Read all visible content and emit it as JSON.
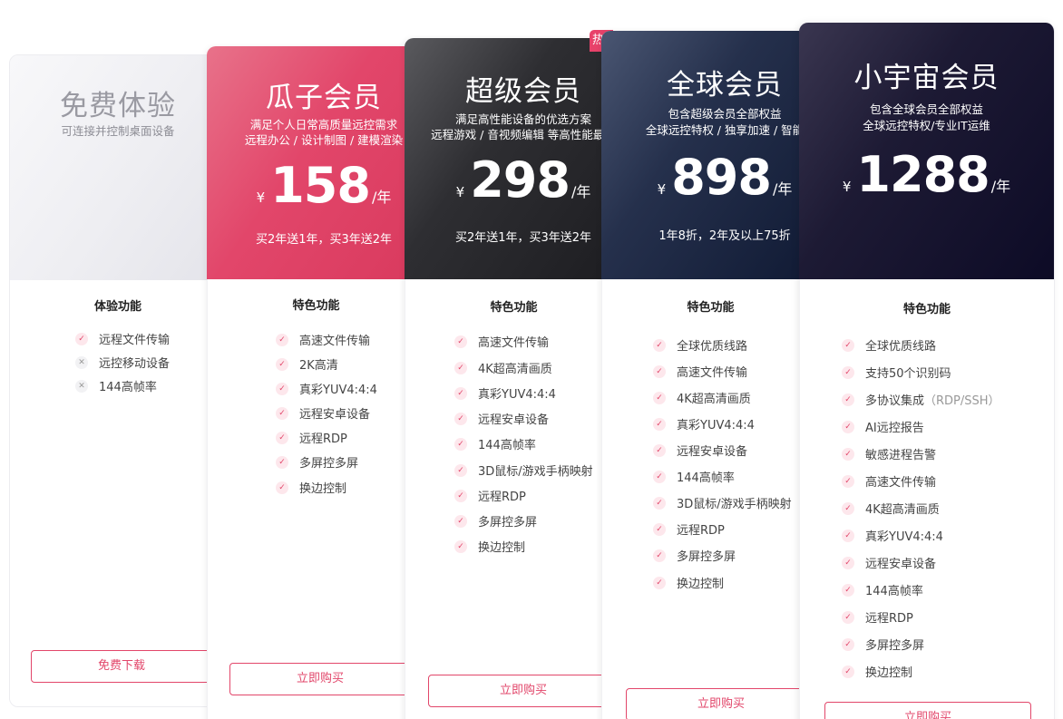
{
  "hot_badge": "热",
  "tiers": [
    {
      "title": "免费体验",
      "subtitle": [
        "可连接并控制桌面设备"
      ],
      "section_title": "体验功能",
      "features": [
        {
          "text": "远程文件传输",
          "enabled": true
        },
        {
          "text": "远控移动设备",
          "enabled": false
        },
        {
          "text": "144高帧率",
          "enabled": false
        }
      ],
      "button": "免费下载"
    },
    {
      "title": "瓜子会员",
      "subtitle": [
        "满足个人日常高质量远控需求",
        "远程办公 / 设计制图 / 建模渲染"
      ],
      "currency": "¥",
      "price": "158",
      "unit": "/年",
      "promo": "买2年送1年，买3年送2年",
      "section_title": "特色功能",
      "features": [
        {
          "text": "高速文件传输"
        },
        {
          "text": "2K高清"
        },
        {
          "text": "真彩YUV4:4:4"
        },
        {
          "text": "远程安卓设备"
        },
        {
          "text": "远程RDP"
        },
        {
          "text": "多屏控多屏"
        },
        {
          "text": "换边控制"
        }
      ],
      "button": "立即购买"
    },
    {
      "title": "超级会员",
      "subtitle": [
        "满足高性能设备的优选方案",
        "远程游戏 / 音视频编辑 等高性能最优"
      ],
      "currency": "¥",
      "price": "298",
      "unit": "/年",
      "promo": "买2年送1年，买3年送2年",
      "section_title": "特色功能",
      "features": [
        {
          "text": "高速文件传输"
        },
        {
          "text": "4K超高清画质"
        },
        {
          "text": "真彩YUV4:4:4"
        },
        {
          "text": "远程安卓设备"
        },
        {
          "text": "144高帧率"
        },
        {
          "text": "3D鼠标/游戏手柄映射"
        },
        {
          "text": "远程RDP"
        },
        {
          "text": "多屏控多屏"
        },
        {
          "text": "换边控制"
        }
      ],
      "button": "立即购买"
    },
    {
      "title": "全球会员",
      "subtitle": [
        "包含超级会员全部权益",
        "全球远控特权 / 独享加速 / 智能"
      ],
      "currency": "¥",
      "price": "898",
      "unit": "/年",
      "promo": "1年8折，2年及以上75折",
      "section_title": "特色功能",
      "features": [
        {
          "text": "全球优质线路"
        },
        {
          "text": "高速文件传输"
        },
        {
          "text": "4K超高清画质"
        },
        {
          "text": "真彩YUV4:4:4"
        },
        {
          "text": "远程安卓设备"
        },
        {
          "text": "144高帧率"
        },
        {
          "text": "3D鼠标/游戏手柄映射"
        },
        {
          "text": "远程RDP"
        },
        {
          "text": "多屏控多屏"
        },
        {
          "text": "换边控制"
        }
      ],
      "button": "立即购买"
    },
    {
      "title": "小宇宙会员",
      "subtitle": [
        "包含全球会员全部权益",
        "全球远控特权/专业IT运维"
      ],
      "currency": "¥",
      "price": "1288",
      "unit": "/年",
      "section_title": "特色功能",
      "features": [
        {
          "text": "全球优质线路"
        },
        {
          "text": "支持50个识别码"
        },
        {
          "text": "多协议集成",
          "extra": "（RDP/SSH）"
        },
        {
          "text": "AI远控报告"
        },
        {
          "text": "敏感进程告警"
        },
        {
          "text": "高速文件传输"
        },
        {
          "text": "4K超高清画质"
        },
        {
          "text": "真彩YUV4:4:4"
        },
        {
          "text": "远程安卓设备"
        },
        {
          "text": "144高帧率"
        },
        {
          "text": "远程RDP"
        },
        {
          "text": "多屏控多屏"
        },
        {
          "text": "换边控制"
        }
      ],
      "button": "立即购买"
    }
  ]
}
